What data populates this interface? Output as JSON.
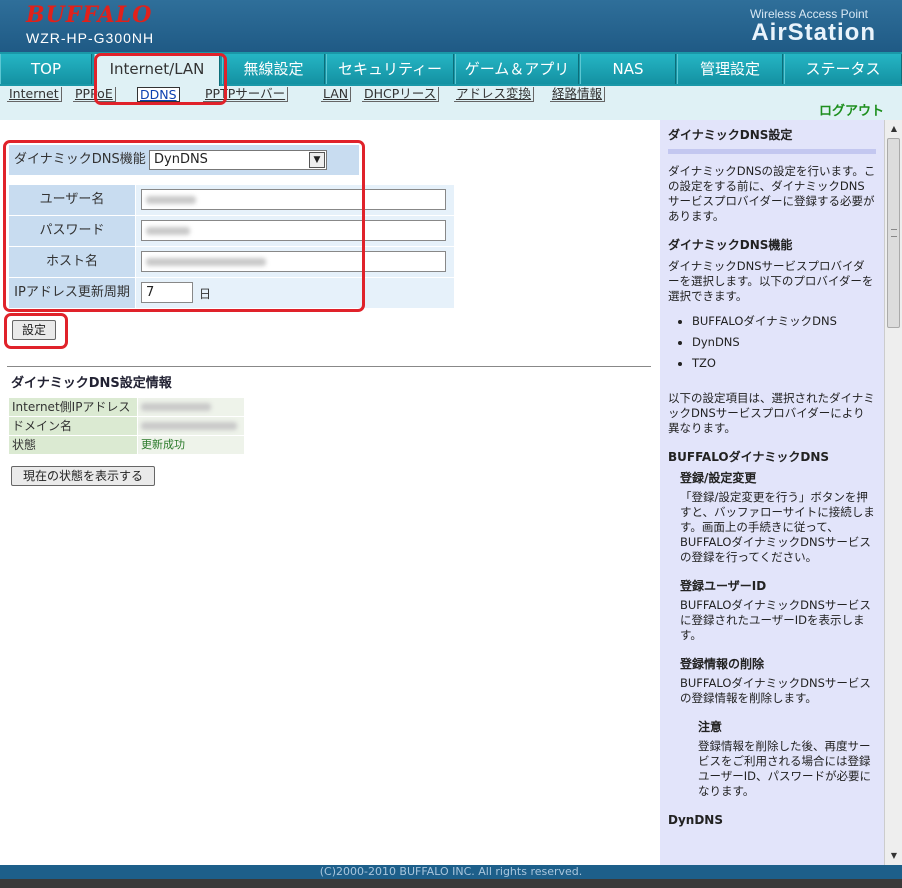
{
  "header": {
    "brand": "BUFFALO",
    "model": "WZR-HP-G300NH",
    "product_line": "Wireless Access Point",
    "product_name": "AirStation"
  },
  "tabs": [
    {
      "label": "TOP"
    },
    {
      "label": "Internet/LAN",
      "active": true
    },
    {
      "label": "無線設定"
    },
    {
      "label": "セキュリティー"
    },
    {
      "label": "ゲーム＆アプリ"
    },
    {
      "label": "NAS"
    },
    {
      "label": "管理設定"
    },
    {
      "label": "ステータス"
    }
  ],
  "subtabs": [
    {
      "label": "Internet"
    },
    {
      "label": "PPPoE"
    },
    {
      "label": "DDNS",
      "active": true
    },
    {
      "label": "PPTPサーバー"
    },
    {
      "label": "LAN"
    },
    {
      "label": "DHCPリース"
    },
    {
      "label": "アドレス変換"
    },
    {
      "label": "経路情報"
    }
  ],
  "logout": "ログアウト",
  "form": {
    "ddns_label": "ダイナミックDNS機能",
    "ddns_value": "DynDNS",
    "user_label": "ユーザー名",
    "password_label": "パスワード",
    "host_label": "ホスト名",
    "interval_label": "IPアドレス更新周期",
    "interval_value": "7",
    "interval_unit": "日",
    "submit": "設定"
  },
  "info": {
    "title": "ダイナミックDNS設定情報",
    "ip_label": "Internet側IPアドレス",
    "domain_label": "ドメイン名",
    "status_label": "状態",
    "status_value": "更新成功",
    "show_button": "現在の状態を表示する"
  },
  "help": {
    "title": "ダイナミックDNS設定",
    "intro": "ダイナミックDNSの設定を行います。この設定をする前に、ダイナミックDNSサービスプロバイダーに登録する必要があります。",
    "func_title": "ダイナミックDNS機能",
    "func_text": "ダイナミックDNSサービスプロバイダーを選択します。以下のプロバイダーを選択できます。",
    "providers": [
      "BUFFALOダイナミックDNS",
      "DynDNS",
      "TZO"
    ],
    "items_text": "以下の設定項目は、選択されたダイナミックDNSサービスプロバイダーにより異なります。",
    "buffalo_title": "BUFFALOダイナミックDNS",
    "reg_title": "登録/設定変更",
    "reg_text": "「登録/設定変更を行う」ボタンを押すと、バッファローサイトに接続します。画面上の手続きに従って、BUFFALOダイナミックDNSサービスの登録を行ってください。",
    "userid_title": "登録ユーザーID",
    "userid_text": "BUFFALOダイナミックDNSサービスに登録されたユーザーIDを表示します。",
    "delete_title": "登録情報の削除",
    "delete_text": "BUFFALOダイナミックDNSサービスの登録情報を削除します。",
    "note_title": "注意",
    "note_text": "登録情報を削除した後、再度サービスをご利用される場合には登録ユーザーID、パスワードが必要になります。",
    "dyndns_title": "DynDNS"
  },
  "footer": "(C)2000-2010 BUFFALO INC. All rights reserved."
}
